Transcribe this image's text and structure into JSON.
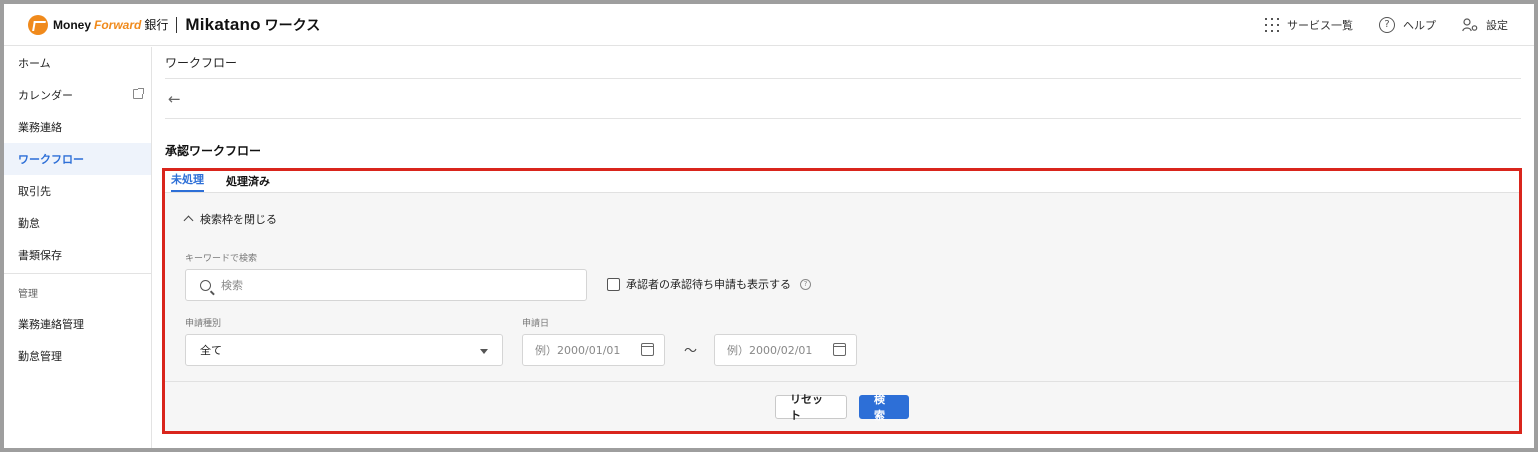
{
  "header": {
    "brand_money": "Money",
    "brand_forward": "Forward",
    "brand_bank": "銀行",
    "brand_mikatano": "Mikatano",
    "brand_works": "ワークス",
    "service_list": "サービス一覧",
    "help": "ヘルプ",
    "settings": "設定",
    "accent_color": "#f08a1c"
  },
  "sidebar": {
    "items": [
      {
        "label": "ホーム"
      },
      {
        "label": "カレンダー"
      },
      {
        "label": "業務連絡"
      },
      {
        "label": "ワークフロー"
      },
      {
        "label": "取引先"
      },
      {
        "label": "勤怠"
      },
      {
        "label": "書類保存"
      }
    ],
    "section_label": "管理",
    "admin_items": [
      {
        "label": "業務連絡管理"
      },
      {
        "label": "勤怠管理"
      }
    ],
    "active_color": "#2d6fd7"
  },
  "main": {
    "page_title": "ワークフロー",
    "back_icon": "←",
    "section_title": "承認ワークフロー",
    "tabs": [
      {
        "label": "未処理"
      },
      {
        "label": "処理済み"
      }
    ],
    "search": {
      "collapse_label": "検索枠を閉じる",
      "keyword_label": "キーワードで検索",
      "keyword_placeholder": "検索",
      "checkbox_label": "承認者の承認待ち申請も表示する",
      "type_label": "申請種別",
      "type_value": "全て",
      "date_label": "申請日",
      "date_from_placeholder": "例）2000/01/01",
      "date_to_placeholder": "例）2000/02/01",
      "tilde": "〜"
    },
    "buttons": {
      "reset": "リセット",
      "search": "検索"
    }
  }
}
